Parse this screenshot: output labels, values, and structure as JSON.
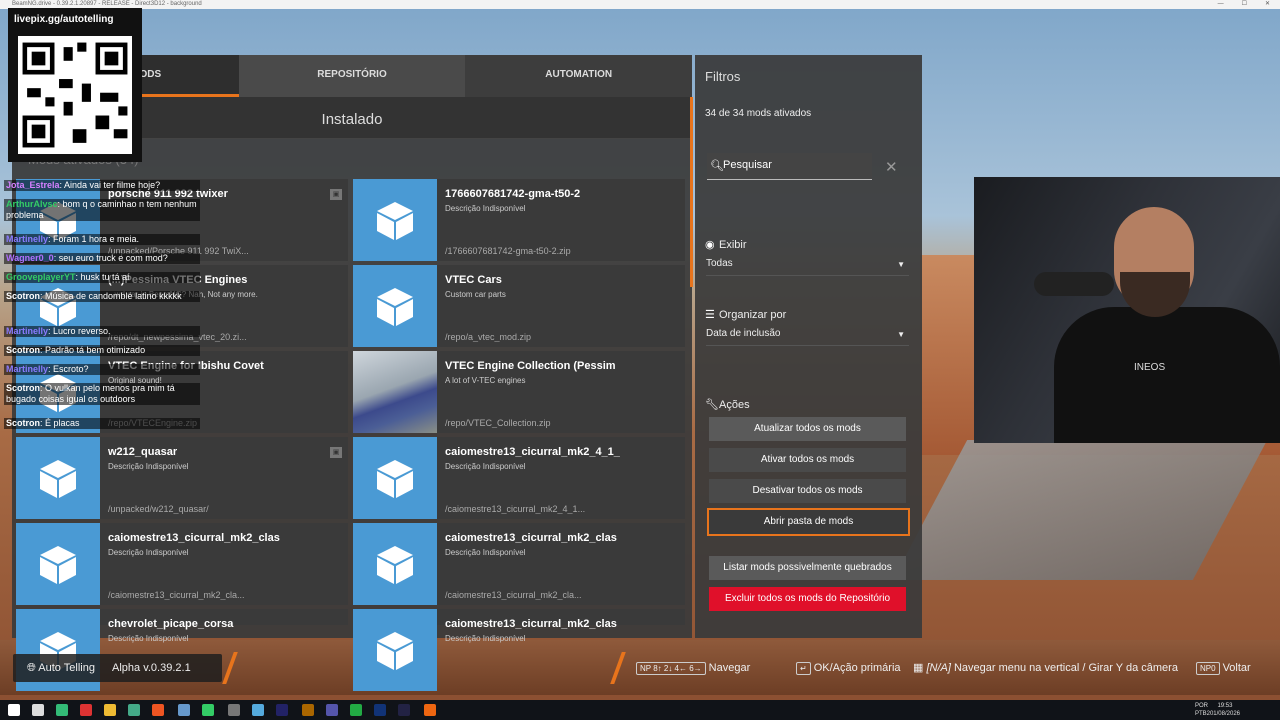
{
  "window": {
    "title": "BeamNG.drive - 0.39.2.1.20897 - RELEASE - Direct3D12 - background"
  },
  "tabs": [
    "DOR DE MODS",
    "REPOSITÓRIO",
    "AUTOMATION"
  ],
  "section_title": "Instalado",
  "subheading": "Mods ativados (34)",
  "mods": [
    {
      "title": "porsche 911 992 twixer",
      "desc": "",
      "path": "/unpacked/Porsche 911 992 TwiX...",
      "thumb": "box"
    },
    {
      "title": "1766607681742-gma-t50-2",
      "desc": "Descrição Indisponível",
      "path": "/1766607681742-gma-t50-2.zip",
      "thumb": "box"
    },
    {
      "title": "(...)Pessima VTEC Engines",
      "desc": "...wd car in BeamNG? Nah, Not any more.",
      "path": "/repo/dt_newpessima_vtec_20.zi...",
      "thumb": "box"
    },
    {
      "title": "VTEC Cars",
      "desc": "Custom car parts",
      "path": "/repo/a_vtec_mod.zip",
      "thumb": "box"
    },
    {
      "title": "VTEC Engine for Ibishu Covet",
      "desc": "Original sound!",
      "path": "/repo/VTECEngine.zip",
      "thumb": "box"
    },
    {
      "title": "VTEC Engine Collection (Pessim",
      "desc": "A lot of V-TEC engines",
      "path": "/repo/VTEC_Collection.zip",
      "thumb": "photo"
    },
    {
      "title": "w212_quasar",
      "desc": "Descrição Indisponível",
      "path": "/unpacked/w212_quasar/",
      "thumb": "box"
    },
    {
      "title": "caiomestre13_cicurral_mk2_4_1_",
      "desc": "Descrição Indisponível",
      "path": "/caiomestre13_cicurral_mk2_4_1...",
      "thumb": "box"
    },
    {
      "title": "caiomestre13_cicurral_mk2_clas",
      "desc": "Descrição Indisponível",
      "path": "/caiomestre13_cicurral_mk2_cla...",
      "thumb": "box"
    },
    {
      "title": "caiomestre13_cicurral_mk2_clas",
      "desc": "Descrição Indisponível",
      "path": "/caiomestre13_cicurral_mk2_cla...",
      "thumb": "box"
    },
    {
      "title": "chevrolet_picape_corsa",
      "desc": "Descrição Indisponível",
      "path": "",
      "thumb": "box"
    },
    {
      "title": "caiomestre13_cicurral_mk2_clas",
      "desc": "Descrição Indisponível",
      "path": "",
      "thumb": "box"
    }
  ],
  "filters": {
    "title": "Filtros",
    "count": "34 de 34 mods ativados",
    "search_placeholder": "Pesquisar",
    "show_label": "Exibir",
    "show_value": "Todas",
    "sort_label": "Organizar por",
    "sort_value": "Data de inclusão",
    "actions_label": "Ações",
    "buttons": {
      "update_all": "Atualizar todos os mods",
      "enable_all": "Ativar todos os mods",
      "disable_all": "Desativar todos os mods",
      "open_folder": "Abrir pasta de mods",
      "list_broken": "Listar mods possivelmente quebrados",
      "delete_repo": "Excluir todos os mods do Repositório"
    }
  },
  "qr": {
    "url": "livepix.gg/autotelling"
  },
  "chat": [
    {
      "user": "Jota_Estrela",
      "color": "#d580ff",
      "text": ": Ainda vai ter filme hoje?"
    },
    {
      "user": "ArthurAlvsc",
      "color": "#33cc66",
      "text": ": bom q o caminhao n tem nenhum problema"
    },
    {
      "user": "Martinelly",
      "color": "#8a7bff",
      "text": ": Foram 1 hora e meia."
    },
    {
      "user": "Wagner0_0",
      "color": "#b070ff",
      "text": ": seu euro truck e com mod?"
    },
    {
      "user": "GrooveplayerYT",
      "color": "#33cc66",
      "text": ": husk tu tá aí"
    },
    {
      "user": "Scotron",
      "color": "#ffffff",
      "text": ": Música de candomblé latino kkkkk"
    },
    {
      "user": "Martinelly",
      "color": "#8a7bff",
      "text": ": Lucro reverso."
    },
    {
      "user": "Scotron",
      "color": "#ffffff",
      "text": ": Padrão tá bem otimizado"
    },
    {
      "user": "Martinelly",
      "color": "#8a7bff",
      "text": ": Escroto?"
    },
    {
      "user": "Scotron",
      "color": "#ffffff",
      "text": ": O vulkan pelo menos pra mim tá bugado coisas igual os outdoors"
    },
    {
      "user": "Scotron",
      "color": "#ffffff",
      "text": ": É placas"
    }
  ],
  "webcam": {
    "shirt_text": "INEOS"
  },
  "bottom": {
    "profile": "Auto Telling",
    "version": "Alpha v.0.39.2.1",
    "keys": "NP 8↑ 2↓ 4← 6→",
    "navigate": "Navegar",
    "ok": "OK/Ação primária",
    "na_key": "[N/A]",
    "nav_menu": "Navegar menu na vertical / Girar Y da câmera",
    "back_key": "NP0",
    "back": "Voltar"
  },
  "taskbar": {
    "lang1": "POR",
    "lang2": "PTB2",
    "time": "19:53",
    "date": "01/08/2026"
  }
}
